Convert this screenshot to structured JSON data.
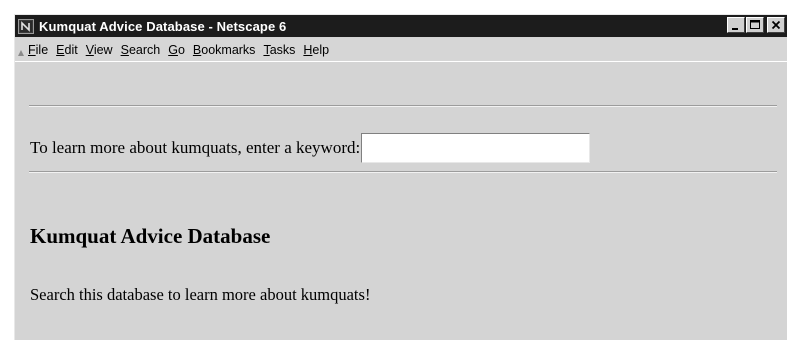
{
  "window": {
    "title": "Kumquat Advice Database - Netscape 6",
    "controls": {
      "minimize_icon": "minimize-icon",
      "maximize_icon": "maximize-icon",
      "close_icon": "close-icon"
    }
  },
  "menubar": {
    "items": [
      {
        "accel": "F",
        "rest": "ile"
      },
      {
        "accel": "E",
        "rest": "dit"
      },
      {
        "accel": "V",
        "rest": "iew"
      },
      {
        "accel": "S",
        "rest": "earch"
      },
      {
        "accel": "G",
        "rest": "o"
      },
      {
        "accel": "B",
        "rest": "ookmarks"
      },
      {
        "accel": "T",
        "rest": "asks"
      },
      {
        "accel": "H",
        "rest": "elp"
      }
    ]
  },
  "form": {
    "prompt": "To learn more about kumquats, enter a keyword:",
    "keyword_value": ""
  },
  "page": {
    "heading": "Kumquat Advice Database",
    "description": "Search this database to learn more about kumquats!"
  },
  "colors": {
    "titlebar": "#1c1c1c",
    "chrome": "#d4d4d4",
    "input_bg": "#ffffff"
  }
}
